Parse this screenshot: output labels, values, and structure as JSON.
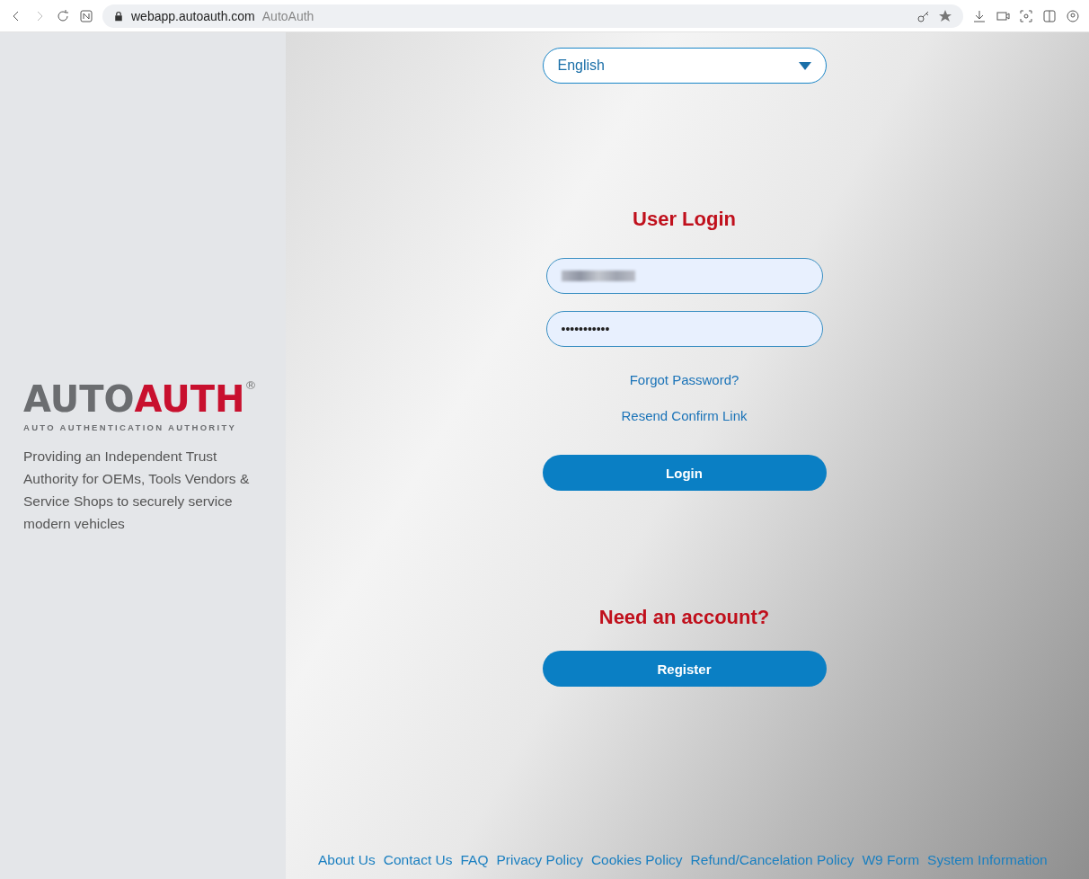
{
  "browser": {
    "url": "webapp.autoauth.com",
    "page_title": "AutoAuth"
  },
  "brand": {
    "logo_left": "AUTO",
    "logo_right": "AUTH",
    "registered": "®",
    "subtitle": "AUTO AUTHENTICATION AUTHORITY",
    "tagline": "Providing an Independent Trust Authority for OEMs, Tools Vendors & Service Shops to securely service modern vehicles"
  },
  "language": {
    "value": "English"
  },
  "login": {
    "title": "User Login",
    "password": "•••••••••••",
    "links": [
      "Forgot Password?",
      "Resend Confirm Link"
    ],
    "button": "Login"
  },
  "register": {
    "title": "Need an account?",
    "button": "Register"
  },
  "footer_links": [
    "About Us",
    "Contact Us",
    "FAQ",
    "Privacy Policy",
    "Cookies Policy",
    "Refund/Cancelation Policy",
    "W9 Form",
    "System Information"
  ]
}
